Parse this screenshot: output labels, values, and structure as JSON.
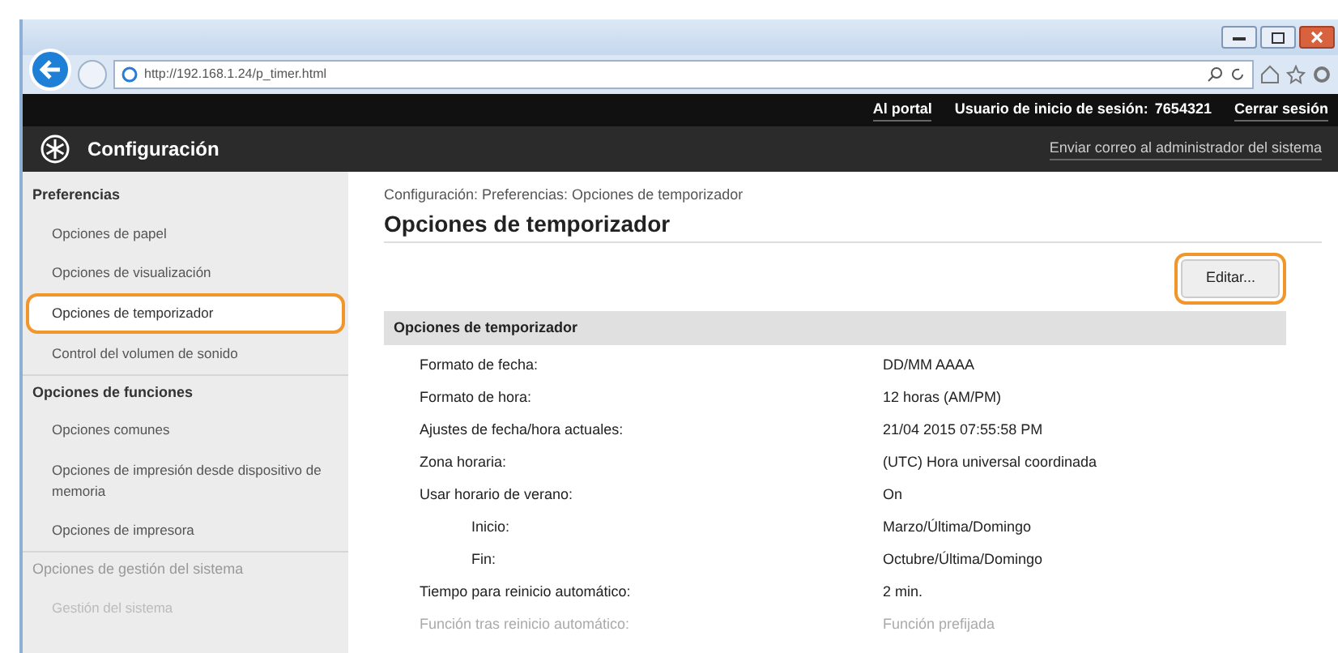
{
  "browser": {
    "url": "http://192.168.1.24/p_timer.html"
  },
  "topbar": {
    "links": [
      "Al portal"
    ],
    "user_label": "Usuario de inicio de sesión:",
    "user_id": "7654321",
    "logout": "Cerrar sesión"
  },
  "header": {
    "title": "Configuración",
    "mail_link": "Enviar correo al administrador del sistema"
  },
  "sidebar": [
    {
      "heading": "Preferencias",
      "dimmed": false,
      "items": [
        {
          "label": "Opciones de papel",
          "selected": false,
          "highlighted": false
        },
        {
          "label": "Opciones de visualización",
          "selected": false,
          "highlighted": false
        },
        {
          "label": "Opciones de temporizador",
          "selected": true,
          "highlighted": true
        },
        {
          "label": "Control del volumen de sonido",
          "selected": false,
          "highlighted": false
        }
      ]
    },
    {
      "heading": "Opciones de funciones",
      "dimmed": false,
      "items": [
        {
          "label": "Opciones comunes",
          "selected": false,
          "highlighted": false
        },
        {
          "label": "Opciones de impresión desde dispositivo de memoria",
          "selected": false,
          "highlighted": false
        },
        {
          "label": "Opciones de impresora",
          "selected": false,
          "highlighted": false
        }
      ]
    },
    {
      "heading": "Opciones de gestión del sistema",
      "dimmed": true,
      "items": [
        {
          "label": "Gestión del sistema",
          "selected": false,
          "highlighted": false
        }
      ]
    }
  ],
  "breadcrumb": "Configuración: Preferencias: Opciones de temporizador",
  "page_title": "Opciones de temporizador",
  "edit_button": {
    "label": "Editar...",
    "highlighted": true
  },
  "section": {
    "title": "Opciones de temporizador",
    "rows": [
      {
        "label": "Formato de fecha:",
        "value": "DD/MM AAAA",
        "indented": false,
        "dimmed": false
      },
      {
        "label": "Formato de hora:",
        "value": "12 horas (AM/PM)",
        "indented": false,
        "dimmed": false
      },
      {
        "label": "Ajustes de fecha/hora actuales:",
        "value": "21/04 2015 07:55:58 PM",
        "indented": false,
        "dimmed": false
      },
      {
        "label": "Zona horaria:",
        "value": "(UTC) Hora universal coordinada",
        "indented": false,
        "dimmed": false
      },
      {
        "label": "Usar horario de verano:",
        "value": "On",
        "indented": false,
        "dimmed": false
      },
      {
        "label": "Inicio:",
        "value": "Marzo/Última/Domingo",
        "indented": true,
        "dimmed": false
      },
      {
        "label": "Fin:",
        "value": "Octubre/Última/Domingo",
        "indented": true,
        "dimmed": false
      },
      {
        "label": "Tiempo para reinicio automático:",
        "value": "2 min.",
        "indented": false,
        "dimmed": false
      },
      {
        "label": "Función tras reinicio automático:",
        "value": "Función prefijada",
        "indented": false,
        "dimmed": true
      }
    ]
  }
}
